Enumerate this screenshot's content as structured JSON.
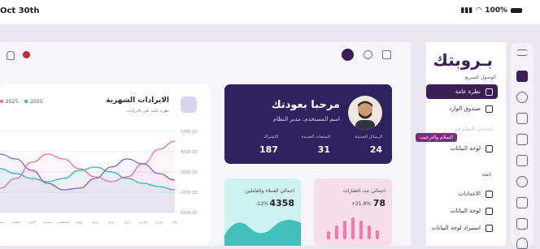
{
  "status": {
    "time": "Oct 30th",
    "battery": "100%"
  },
  "brand": {
    "logo": "بـروبتك"
  },
  "nav": {
    "quick_access_label": "الوصول السريع",
    "items": [
      {
        "label": "نظرة عامة",
        "active": true,
        "icon": "overview-icon"
      },
      {
        "label": "صندوق الوارد",
        "active": false,
        "icon": "inbox-icon"
      },
      {
        "label": "لوحة البيانات",
        "active": false,
        "icon": "chart-icon"
      }
    ],
    "section_label": "الفئة",
    "section_items": [
      {
        "label": "الاعدادات",
        "icon": "settings-icon"
      },
      {
        "label": "لوحة البيانات",
        "icon": "dashboard-icon"
      },
      {
        "label": "استيراد لوحة البيانات",
        "icon": "import-icon"
      }
    ],
    "tooltip": "السلام والترحيب",
    "hidden_label": "إعدادات النظام في"
  },
  "welcome": {
    "title": "مرحبا بعودتك",
    "subtitle": "اسم المستخدم: مدير النظام",
    "stats": [
      {
        "label": "الرسائل الجديدة",
        "value": "24"
      },
      {
        "label": "المنتجات الجديدة",
        "value": "31"
      },
      {
        "label": "الاشتراك",
        "value": "187"
      }
    ]
  },
  "cards": {
    "clients": {
      "title": "اجمالي العملاء والعاملين",
      "value": "4358",
      "change": "-12%",
      "accent": "#2bb7b0"
    },
    "properties": {
      "title": "اجمالي عدد العقارات",
      "value": "78",
      "change": "+31.8%",
      "accent": "#f17aa5"
    }
  },
  "revenue": {
    "title": "الايرادات الشهرية",
    "subtitle": "نظرة عامة على الايرادات",
    "legend": [
      "2025",
      "2025"
    ],
    "legend_colors": [
      "#f26b9a",
      "#2bb7b0"
    ]
  },
  "chart_data": {
    "type": "line",
    "title": "الايرادات الشهرية",
    "ylim": [
      0,
      5000
    ],
    "y_ticks": [
      "5000.00",
      "4000.00",
      "3000.00",
      "2000.00",
      "1000.00"
    ],
    "x": [
      "يناير",
      "فبراير",
      "مارس",
      "ابريل",
      "مايو",
      "يونيو",
      "يوليو",
      "اغسطس",
      "سبتمبر",
      "اكتوبر",
      "نوفمبر",
      "ديسمبر"
    ],
    "series": [
      {
        "color": "#f26b9a",
        "values": [
          1500,
          2100,
          3100,
          3600,
          3300,
          2700,
          2200,
          1900,
          2200,
          3000,
          3900,
          4400
        ]
      },
      {
        "color": "#2bb7b0",
        "values": [
          2700,
          2400,
          2100,
          1900,
          2100,
          2600,
          2800,
          2500,
          2100,
          1800,
          1600,
          1400
        ]
      },
      {
        "color": "#7b5fe0",
        "values": [
          3600,
          3300,
          2600,
          1800,
          1400,
          1500,
          2100,
          2800,
          3300,
          3000,
          2400,
          2000
        ]
      }
    ]
  }
}
